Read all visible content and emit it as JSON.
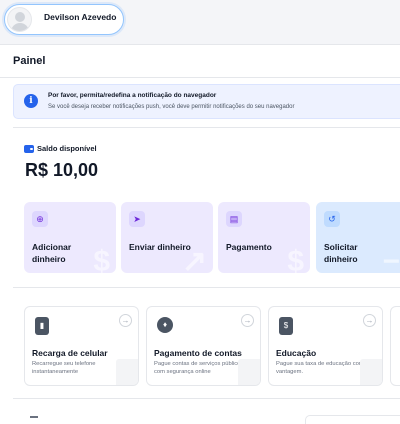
{
  "user": {
    "name": "Devilson Azevedo"
  },
  "panel": {
    "title": "Painel"
  },
  "notice": {
    "icon": "info-icon",
    "title": "Por favor, permita/redefina a notificação do navegador",
    "text": "Se você deseja receber notificações push, você deve permitir notificações do seu navegador"
  },
  "balance": {
    "label": "Saldo disponível",
    "value": "R$ 10,00",
    "icon": "wallet-icon"
  },
  "actions": [
    {
      "label_line1": "Adicionar",
      "label_line2": "dinheiro",
      "icon": "add-money-icon",
      "color": "#ede9fe"
    },
    {
      "label_line1": "Enviar dinheiro",
      "label_line2": "",
      "icon": "send-icon",
      "color": "#ede9fe"
    },
    {
      "label_line1": "Pagamento",
      "label_line2": "",
      "icon": "payment-doc-icon",
      "color": "#ede9fe"
    },
    {
      "label_line1": "Solicitar",
      "label_line2": "dinheiro",
      "icon": "request-money-icon",
      "color": "#dbeafe"
    }
  ],
  "services": [
    {
      "title": "Recarga de celular",
      "desc": "Recarregue seu telefone instantaneamente",
      "icon": "phone-icon"
    },
    {
      "title": "Pagamento de contas",
      "desc": "Pague contas de serviços públicos com segurança online",
      "icon": "flame-icon"
    },
    {
      "title": "Educação",
      "desc": "Pague sua taxa de educação com vantagem.",
      "icon": "money-bag-icon"
    }
  ],
  "colors": {
    "accent": "#2563eb",
    "notice_bg": "#eef2ff"
  }
}
